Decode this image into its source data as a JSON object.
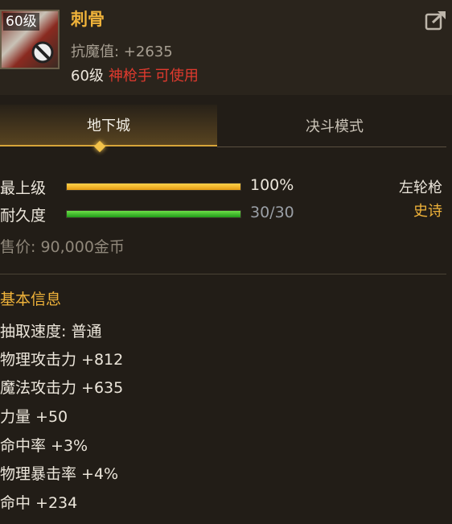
{
  "item": {
    "level_tag": "60级",
    "name": "刺骨",
    "stat_line": "抗魔值: +2635",
    "requirement": {
      "level": "60级",
      "class": "神枪手",
      "usable": "可使用"
    }
  },
  "tabs": [
    {
      "label": "地下城",
      "active": true
    },
    {
      "label": "决斗模式",
      "active": false
    }
  ],
  "grade": {
    "label": "最上级",
    "value": "100%",
    "fill": 1.0
  },
  "durability": {
    "label": "耐久度",
    "value": "30/30",
    "fill": 1.0
  },
  "weapon_type": "左轮枪",
  "rarity": "史诗",
  "price": "售价: 90,000金币",
  "basic_info": {
    "title": "基本信息",
    "attributes": [
      "抽取速度: 普通",
      "物理攻击力 +812",
      "魔法攻击力 +635",
      "力量 +50",
      "命中率 +3%",
      "物理暴击率 +4%",
      "命中 +234"
    ]
  },
  "colors": {
    "accent_gold": "#f0b33a",
    "warning_red": "#e03a2e",
    "background": "#221d17"
  },
  "icons": [
    "no-entry-icon",
    "share-icon",
    "tab-pointer-icon"
  ]
}
